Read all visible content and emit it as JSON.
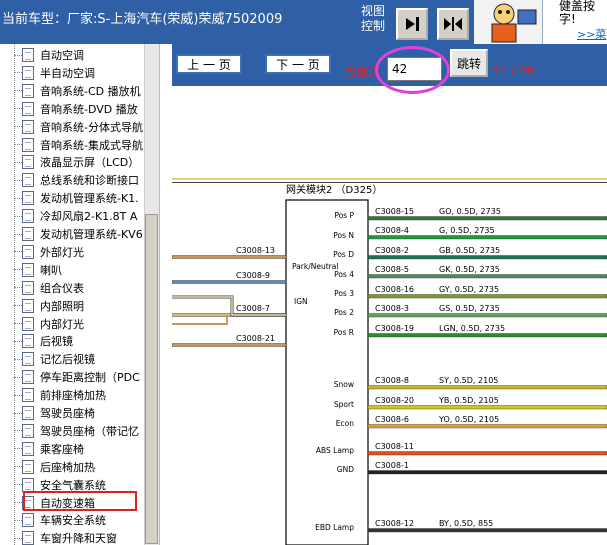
{
  "header": {
    "model_label": "当前车型：厂家:S-上海汽车(荣威)荣威7502009",
    "view_control": "视图控制",
    "help_text": "健盖按字!",
    "help_link": ">>菜"
  },
  "sidebar": {
    "items": [
      {
        "label": "自动空调"
      },
      {
        "label": "半自动空调"
      },
      {
        "label": "音响系统-CD 播放机"
      },
      {
        "label": "音响系统-DVD 播放"
      },
      {
        "label": "音响系统-分体式导航"
      },
      {
        "label": "音响系统-集成式导航"
      },
      {
        "label": "液晶显示屏（LCD）"
      },
      {
        "label": "总线系统和诊断接口"
      },
      {
        "label": "发动机管理系统-K1."
      },
      {
        "label": "冷却风扇2-K1.8T A"
      },
      {
        "label": "发动机管理系统-KV6"
      },
      {
        "label": "外部灯光"
      },
      {
        "label": "喇叭"
      },
      {
        "label": "组合仪表"
      },
      {
        "label": "内部照明"
      },
      {
        "label": "内部灯光"
      },
      {
        "label": "后视镜"
      },
      {
        "label": "记忆后视镜"
      },
      {
        "label": "停车距离控制（PDC"
      },
      {
        "label": "前排座椅加热"
      },
      {
        "label": "驾驶员座椅"
      },
      {
        "label": "驾驶员座椅（带记忆"
      },
      {
        "label": "乘客座椅"
      },
      {
        "label": "后座椅加热"
      },
      {
        "label": "安全气囊系统"
      },
      {
        "label": "自动变速箱"
      },
      {
        "label": "车辆安全系统"
      },
      {
        "label": "车窗升降和天窗"
      }
    ]
  },
  "nav": {
    "prev": "上 一 页",
    "next": "下 一 页",
    "current_label": "当前为",
    "page_value": "42",
    "jump": "跳转",
    "total": "42 / 46"
  },
  "diagram": {
    "module_title": "网关模块2 （D325）",
    "left_connectors": [
      "C3008-13",
      "C3008-9",
      "C3008-7",
      "C3008-21"
    ],
    "left_pins": [
      "Pos P",
      "Pos N",
      "Pos D",
      "Park/Neutral",
      "Pos 4",
      "IGN",
      "Pos 3",
      "Pos 2",
      "Pos R",
      "Snow",
      "Sport",
      "Econ",
      "ABS Lamp",
      "GND",
      "EBD Lamp"
    ],
    "right_wires": [
      {
        "conn": "C3008-15",
        "spec": "GO, 0.5D, 2735",
        "color": "#2b7a3a"
      },
      {
        "conn": "C3008-4",
        "spec": "G, 0.5D, 2735",
        "color": "#1f9a3f"
      },
      {
        "conn": "C3008-2",
        "spec": "GB, 0.5D, 2735",
        "color": "#1e6f55"
      },
      {
        "conn": "C3008-5",
        "spec": "GK, 0.5D, 2735",
        "color": "#4f8a5a"
      },
      {
        "conn": "C3008-16",
        "spec": "GY, 0.5D, 2735",
        "color": "#7a9a2a"
      },
      {
        "conn": "C3008-3",
        "spec": "GS, 0.5D, 2735",
        "color": "#5fa060"
      },
      {
        "conn": "C3008-19",
        "spec": "LGN, 0.5D, 2735",
        "color": "#2d8a2d"
      },
      {
        "conn": "C3008-8",
        "spec": "SY, 0.5D, 2105",
        "color": "#c8b230"
      },
      {
        "conn": "C3008-20",
        "spec": "YB, 0.5D, 2105",
        "color": "#d8c020"
      },
      {
        "conn": "C3008-6",
        "spec": "YO, 0.5D, 2105",
        "color": "#e0a020"
      },
      {
        "conn": "C3008-11",
        "spec": "",
        "color": "#e05020"
      },
      {
        "conn": "C3008-1",
        "spec": "",
        "color": "#222222"
      },
      {
        "conn": "C3008-12",
        "spec": "BY, 0.5D, 855",
        "color": "#333333"
      }
    ]
  }
}
